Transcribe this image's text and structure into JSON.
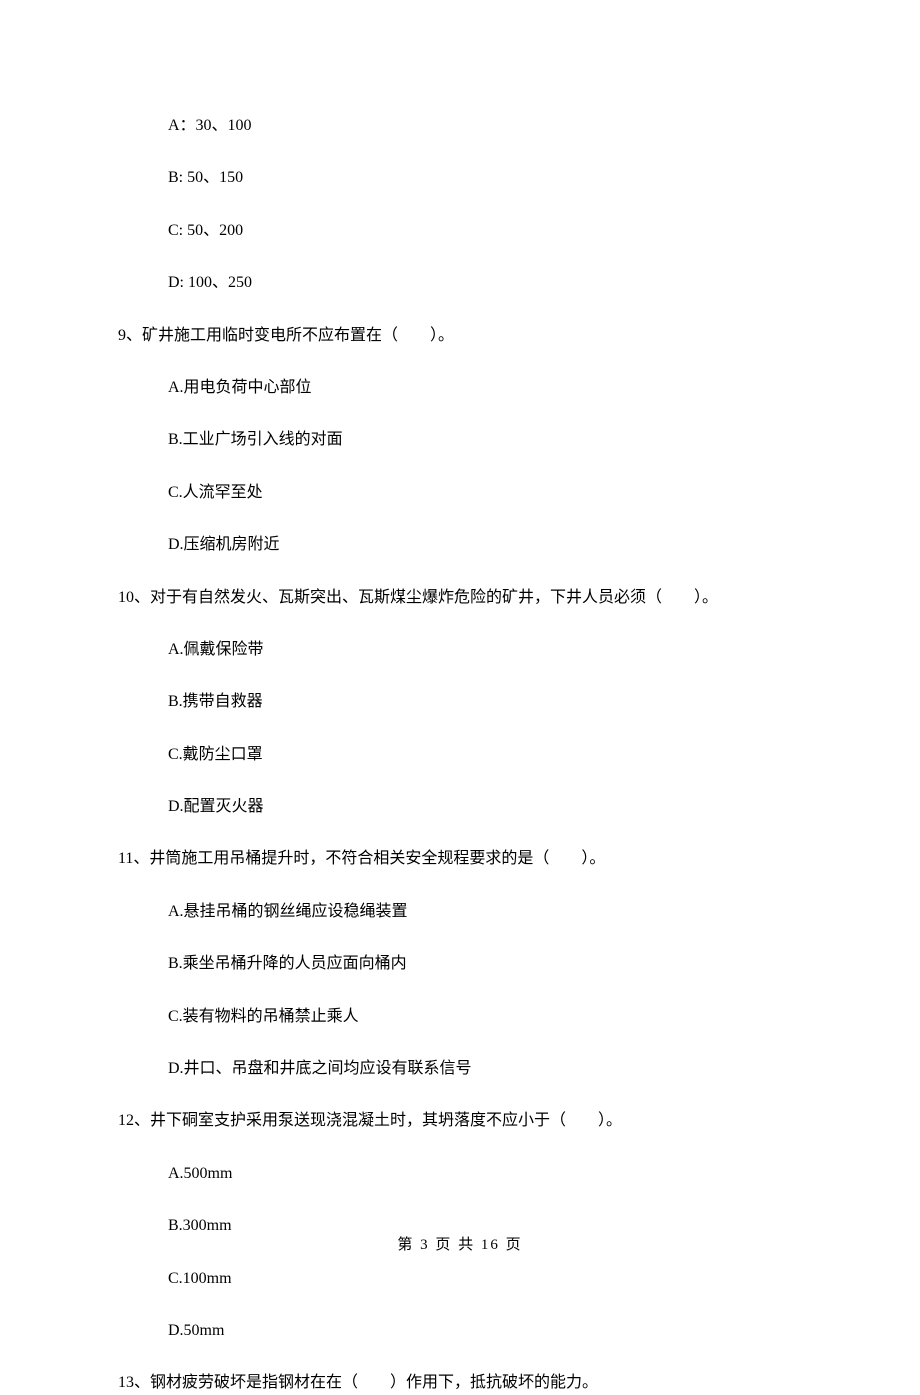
{
  "q8_options": {
    "a": "A：30、100",
    "b": "B: 50、150",
    "c": "C: 50、200",
    "d": "D: 100、250"
  },
  "q9": {
    "stem": "9、矿井施工用临时变电所不应布置在（　　）。",
    "a": "A.用电负荷中心部位",
    "b": "B.工业广场引入线的对面",
    "c": "C.人流罕至处",
    "d": "D.压缩机房附近"
  },
  "q10": {
    "stem": "10、对于有自然发火、瓦斯突出、瓦斯煤尘爆炸危险的矿井，下井人员必须（　　）。",
    "a": "A.佩戴保险带",
    "b": "B.携带自救器",
    "c": "C.戴防尘口罩",
    "d": "D.配置灭火器"
  },
  "q11": {
    "stem": "11、井筒施工用吊桶提升时，不符合相关安全规程要求的是（　　）。",
    "a": "A.悬挂吊桶的钢丝绳应设稳绳装置",
    "b": "B.乘坐吊桶升降的人员应面向桶内",
    "c": "C.装有物料的吊桶禁止乘人",
    "d": "D.井口、吊盘和井底之间均应设有联系信号"
  },
  "q12": {
    "stem": "12、井下硐室支护采用泵送现浇混凝土时，其坍落度不应小于（　　）。",
    "a": "A.500mm",
    "b": "B.300mm",
    "c": "C.100mm",
    "d": "D.50mm"
  },
  "q13": {
    "stem": "13、钢材疲劳破坏是指钢材在在（　　）作用下，抵抗破坏的能力。"
  },
  "footer": "第 3 页 共 16 页"
}
